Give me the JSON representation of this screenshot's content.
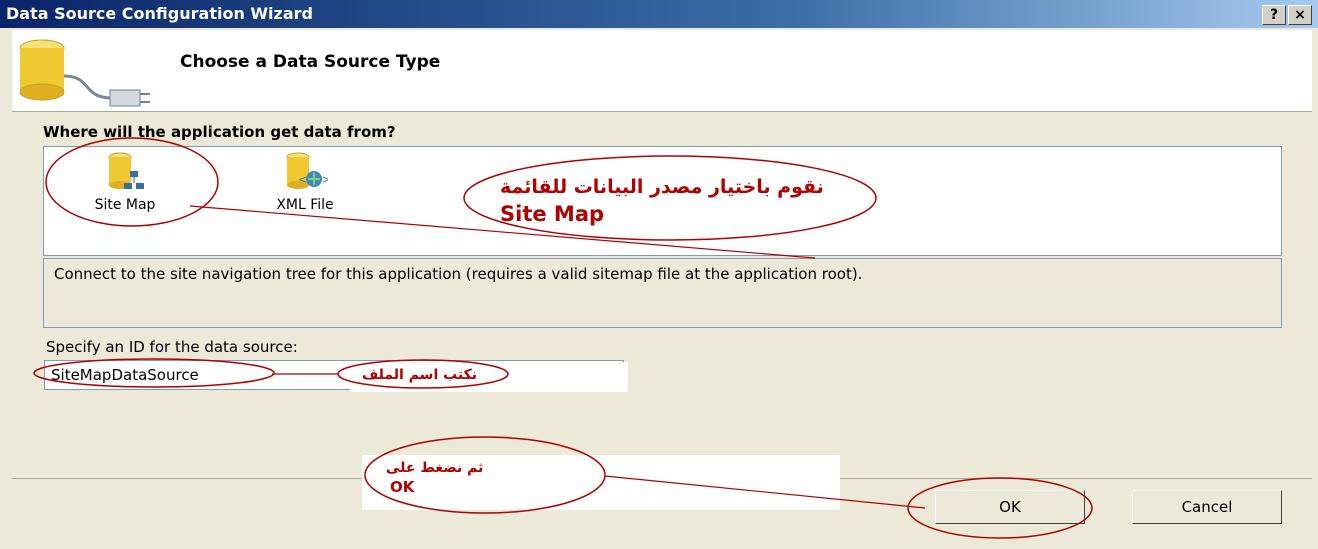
{
  "window": {
    "title": "Data Source Configuration Wizard",
    "help_label": "?",
    "close_label": "×"
  },
  "header": {
    "title": "Choose a Data Source Type"
  },
  "source_section": {
    "label": "Where will the application get data from?",
    "items": [
      {
        "label": "Site Map",
        "icon": "site-map-icon"
      },
      {
        "label": "XML File",
        "icon": "xml-file-icon"
      }
    ],
    "description": "Connect to the site navigation tree for this application (requires a valid sitemap file at the application root)."
  },
  "id_section": {
    "label": "Specify an ID for the data source:",
    "value": "SiteMapDataSource"
  },
  "buttons": {
    "ok": "OK",
    "cancel": "Cancel"
  },
  "annotations": {
    "choose_note_ar": "نقوم باختيار مصدر البيانات للقائمة",
    "choose_note_en": "Site Map",
    "name_note_ar": "نكتب اسم الملف",
    "ok_note_ar": "ثم نضغط على",
    "ok_note_en": "OK",
    "color": "#b00000"
  }
}
